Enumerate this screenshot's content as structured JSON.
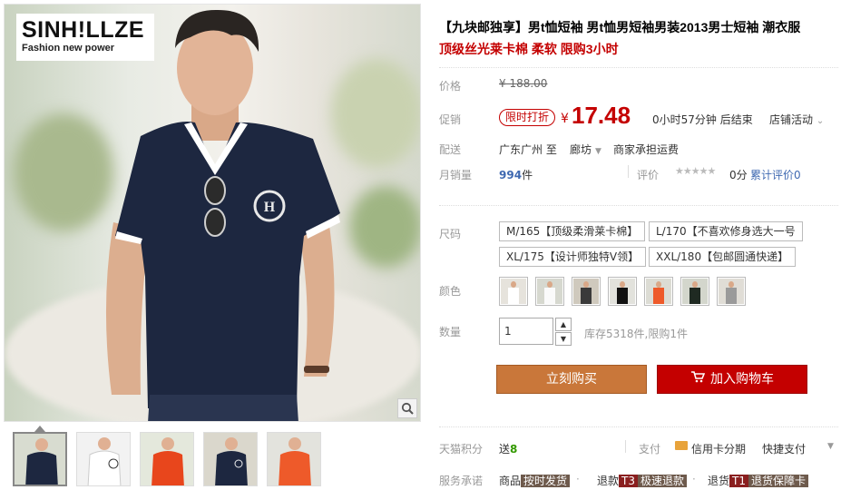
{
  "brand": {
    "name": "SINH!LLZE",
    "tagline": "Fashion new power"
  },
  "gallery": {
    "thumb_count": 5,
    "active_index": 0
  },
  "product": {
    "title": "【九块邮独享】男t恤短袖 男t恤男短袖男装2013男士短袖 潮衣服",
    "subtitle": "顶级丝光莱卡棉 柔软 限购3小时"
  },
  "price": {
    "label": "价格",
    "original": "¥ 188.00"
  },
  "promo": {
    "label": "促销",
    "tag": "限时打折",
    "currency": "¥",
    "price": "17.48",
    "countdown": "0小时57分钟 后结束",
    "shop_promo": "店铺活动"
  },
  "shipping": {
    "label": "配送",
    "from": "广东广州 至",
    "to": "廊坊",
    "fee": "商家承担运费"
  },
  "sales": {
    "label": "月销量",
    "count": "994",
    "unit": "件",
    "rating_label": "评价",
    "stars": "★★★★★",
    "score": "0分",
    "review_link": "累计评价0"
  },
  "size": {
    "label": "尺码",
    "options": [
      "M/165【顶级柔滑莱卡棉】",
      "L/170【不喜欢修身选大一号",
      "XL/175【设计师独特V领】",
      "XXL/180【包邮圆通快递】"
    ]
  },
  "color": {
    "label": "颜色",
    "option_count": 7
  },
  "quantity": {
    "label": "数量",
    "value": "1",
    "stock": "库存5318件,限购1件"
  },
  "actions": {
    "buy": "立刻购买",
    "cart": "加入购物车"
  },
  "points": {
    "label": "天猫积分",
    "give": "送",
    "amount": "8"
  },
  "payment": {
    "label": "支付",
    "credit": "信用卡分期",
    "fast": "快捷支付"
  },
  "service": {
    "label": "服务承诺",
    "goods": "商品",
    "goods_badge": "按时发货",
    "return": "退款",
    "return_code": "T3",
    "return_badge": "极速退款",
    "exchange": "退货",
    "exchange_code": "T1",
    "exchange_badge": "退货保障卡"
  },
  "colors": {
    "price_red": "#c40000",
    "buy_orange": "#c9773a",
    "link_blue": "#3f69b1",
    "points_green": "#339900"
  }
}
